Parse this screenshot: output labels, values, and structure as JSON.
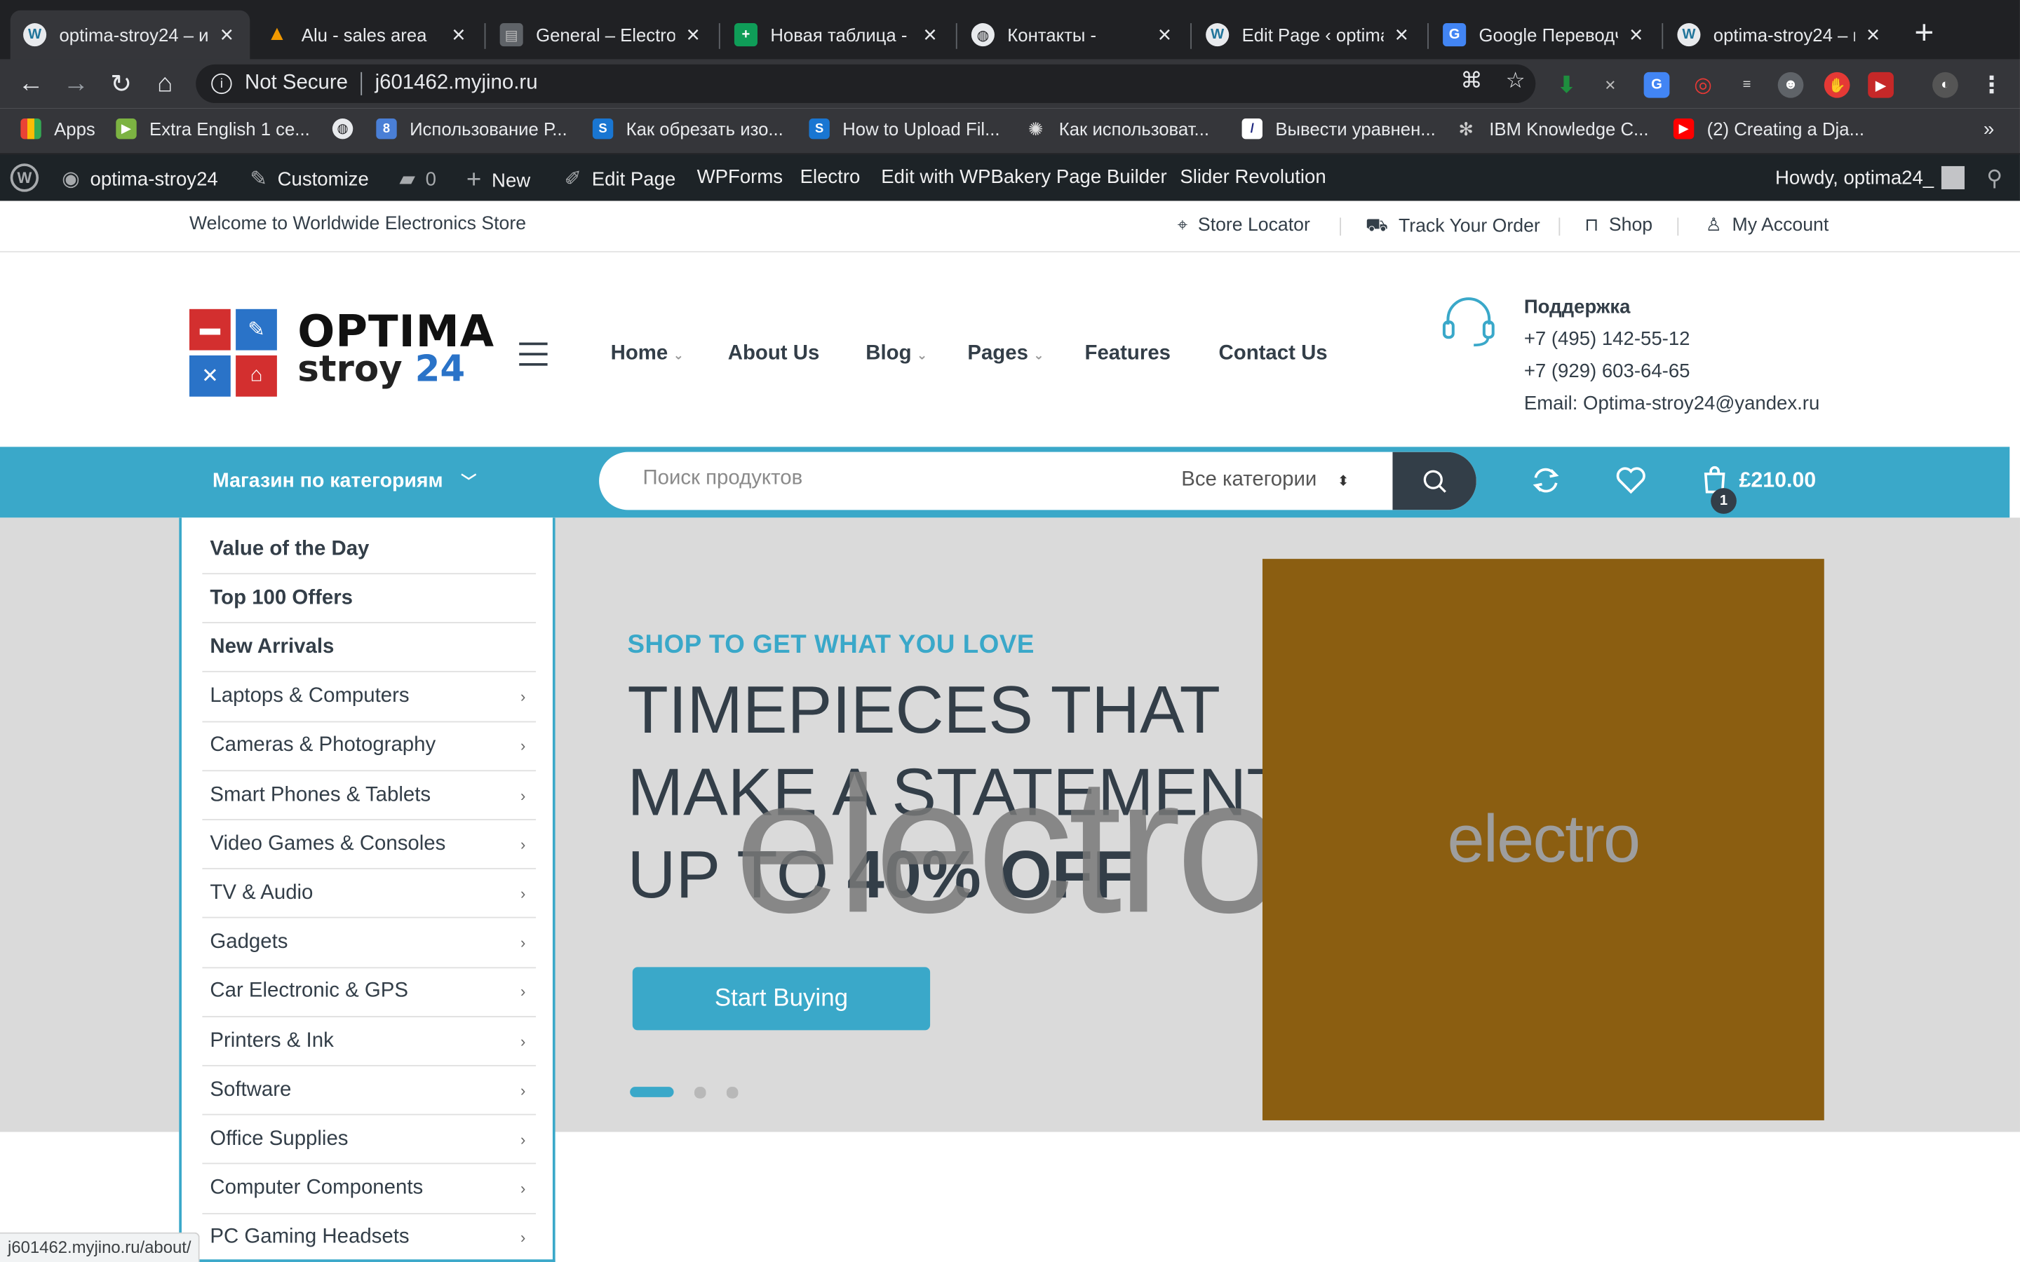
{
  "browser": {
    "tabs": [
      {
        "title": "optima-stroy24 – и",
        "icon": "wordpress-icon"
      },
      {
        "title": "Alu - sales area",
        "icon": "warning-triangle-icon"
      },
      {
        "title": "General – Electro I",
        "icon": "document-icon"
      },
      {
        "title": "Новая таблица - G",
        "icon": "google-sheets-icon"
      },
      {
        "title": "Контакты -",
        "icon": "globe-icon"
      },
      {
        "title": "Edit Page ‹ optima",
        "icon": "wordpress-icon"
      },
      {
        "title": "Google Переводч",
        "icon": "google-translate-icon"
      },
      {
        "title": "optima-stroy24 – и",
        "icon": "wordpress-icon"
      }
    ],
    "address": {
      "security": "Not Secure",
      "url": "j601462.myjino.ru"
    },
    "bookmarks": [
      {
        "label": "Apps"
      },
      {
        "label": "Extra English 1 се..."
      },
      {
        "label": ""
      },
      {
        "label": "Использование Р..."
      },
      {
        "label": "Как обрезать изо..."
      },
      {
        "label": "How to Upload Fil..."
      },
      {
        "label": "Как использоват..."
      },
      {
        "label": "Вывести уравнен..."
      },
      {
        "label": "IBM Knowledge C..."
      },
      {
        "label": "(2) Creating a Dja..."
      }
    ],
    "bookmarks_more": "»",
    "status_url": "j601462.myjino.ru/about/"
  },
  "wpbar": {
    "site": "optima-stroy24",
    "customize": "Customize",
    "comments": "0",
    "new": "New",
    "edit_page": "Edit Page",
    "wpforms": "WPForms",
    "electro": "Electro",
    "wpbakery": "Edit with WPBakery Page Builder",
    "slider": "Slider Revolution",
    "howdy": "Howdy, optima24_"
  },
  "topbar": {
    "welcome": "Welcome to Worldwide Electronics Store",
    "links": [
      "Store Locator",
      "Track Your Order",
      "Shop",
      "My Account"
    ]
  },
  "header": {
    "logo_line1": "OPTIMA",
    "logo_line2": "stroy",
    "logo_number": "24",
    "nav": [
      "Home",
      "About Us",
      "Blog",
      "Pages",
      "Features",
      "Contact Us"
    ],
    "support": {
      "title": "Поддержка",
      "phone1": "+7 (495) 142-55-12",
      "phone2": "+7 (929) 603-64-65",
      "email": "Email: Optima-stroy24@yandex.ru"
    }
  },
  "navbar": {
    "categories_label": "Магазин по категориям",
    "search_placeholder": "Поиск продуктов",
    "search_category": "Все категории",
    "cart_total": "£210.00",
    "cart_count": "1"
  },
  "hero": {
    "subtitle": "SHOP TO GET WHAT YOU LOVE",
    "line1": "TIMEPIECES THAT",
    "line2": "MAKE A STATEMENT",
    "line3_prefix": "UP TO ",
    "line3_strong": "40% OFF",
    "watermark": "electro",
    "button": "Start Buying",
    "image_text": "electro",
    "slides": 3,
    "active_slide": 1
  },
  "categories": [
    {
      "label": "Value of the Day",
      "bold": true,
      "sub": false
    },
    {
      "label": "Top 100 Offers",
      "bold": true,
      "sub": false
    },
    {
      "label": "New Arrivals",
      "bold": true,
      "sub": false
    },
    {
      "label": "Laptops & Computers",
      "bold": false,
      "sub": true
    },
    {
      "label": "Cameras & Photography",
      "bold": false,
      "sub": true
    },
    {
      "label": "Smart Phones & Tablets",
      "bold": false,
      "sub": true
    },
    {
      "label": "Video Games & Consoles",
      "bold": false,
      "sub": true
    },
    {
      "label": "TV & Audio",
      "bold": false,
      "sub": true
    },
    {
      "label": "Gadgets",
      "bold": false,
      "sub": true
    },
    {
      "label": "Car Electronic & GPS",
      "bold": false,
      "sub": true
    },
    {
      "label": "Printers & Ink",
      "bold": false,
      "sub": true
    },
    {
      "label": "Software",
      "bold": false,
      "sub": true
    },
    {
      "label": "Office Supplies",
      "bold": false,
      "sub": true
    },
    {
      "label": "Computer Components",
      "bold": false,
      "sub": true
    },
    {
      "label": "PC Gaming Headsets",
      "bold": false,
      "sub": true
    }
  ],
  "colors": {
    "accent": "#3aa8c9",
    "dark": "#333e48",
    "hero_bg": "#dadada",
    "hero_image": "#8b5e11"
  }
}
